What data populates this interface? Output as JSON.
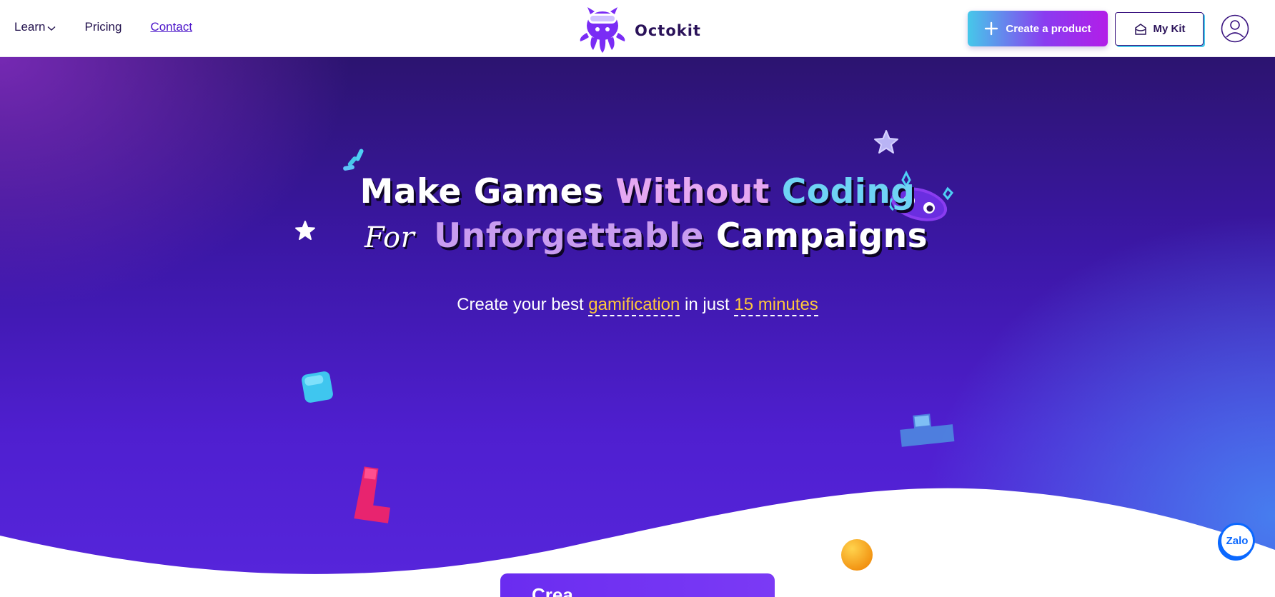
{
  "header": {
    "nav": [
      {
        "label": "Learn"
      },
      {
        "label": "Pricing"
      },
      {
        "label": "Contact"
      }
    ],
    "brand": "Octokit",
    "create_label": "Create a product",
    "mykit_label": "My Kit"
  },
  "hero": {
    "line1": {
      "make": "Make",
      "games": "Games",
      "without": "Without",
      "coding": "Coding"
    },
    "line2": {
      "for": "For",
      "unforgettable": "Unforgettable",
      "campaigns": "Campaigns"
    },
    "subtitle": {
      "pre": "Create your best",
      "hl1": "gamification",
      "mid": "in just",
      "hl2": "15 minutes"
    }
  },
  "cta_label": "Crea",
  "zalo_label": "Zalo",
  "colors": {
    "primary": "#4b14c9",
    "accent": "#46c8ea",
    "highlight": "#ffc83a",
    "zalo": "#0a68ff"
  }
}
